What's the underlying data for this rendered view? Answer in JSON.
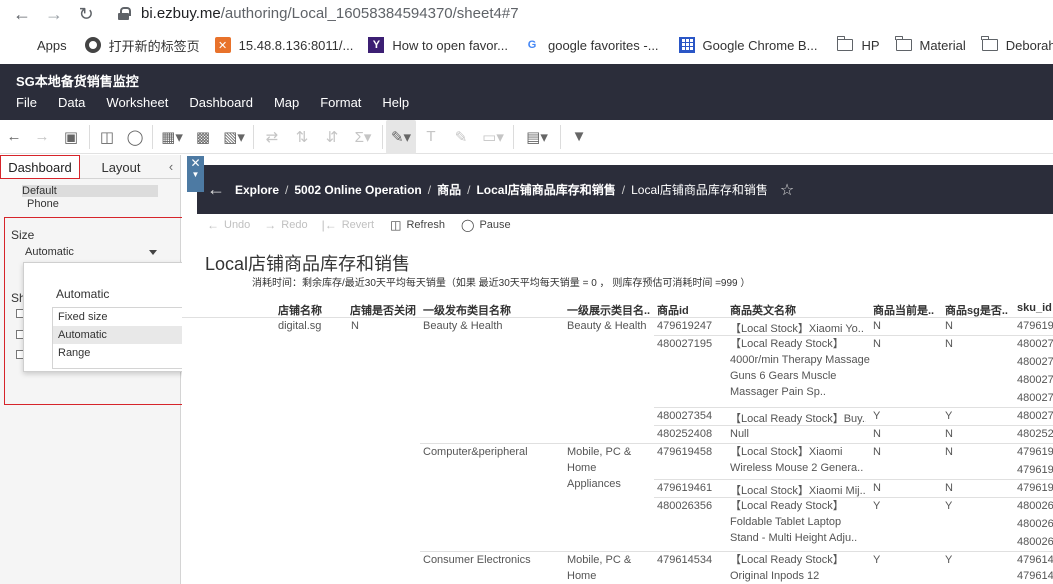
{
  "browser": {
    "url_host": "bi.ezbuy.me",
    "url_path": "/authoring/Local_16058384594370/sheet4#7",
    "bookmarks": [
      {
        "label": "Apps",
        "icon": "apps-icon"
      },
      {
        "label": "打开新的标签页",
        "icon": "globe-icon"
      },
      {
        "label": "15.48.8.136:8011/...",
        "icon": "xampp-icon"
      },
      {
        "label": "How to open favor...",
        "icon": "yahoo-icon"
      },
      {
        "label": "google favorites -...",
        "icon": "google-icon"
      },
      {
        "label": "Google Chrome B...",
        "icon": "grid-icon"
      },
      {
        "label": "HP",
        "icon": "folder-icon"
      },
      {
        "label": "Material",
        "icon": "folder-icon"
      },
      {
        "label": "Deborah",
        "icon": "folder-icon"
      }
    ]
  },
  "app": {
    "title": "SG本地备货销售监控",
    "menu": [
      "File",
      "Data",
      "Worksheet",
      "Dashboard",
      "Map",
      "Format",
      "Help"
    ]
  },
  "pane": {
    "tab_dashboard": "Dashboard",
    "tab_layout": "Layout",
    "device_default": "Default",
    "device_phone": "Phone",
    "size_label": "Size",
    "size_value": "Automatic",
    "sheets_label_partial": "Sh"
  },
  "popup": {
    "selected": "Automatic",
    "options": [
      "Fixed size",
      "Automatic",
      "Range"
    ]
  },
  "canvas": {
    "breadcrumbs": [
      "Explore",
      "5002 Online Operation",
      "商品",
      "Local店铺商品库存和销售",
      "Local店铺商品库存和销售"
    ],
    "toolbar": {
      "undo": "Undo",
      "redo": "Redo",
      "revert": "Revert",
      "refresh": "Refresh",
      "pause": "Pause"
    },
    "title": "Local店铺商品库存和销售",
    "subtitle": "消耗时间：剩余库存/最近30天平均每天销量（如果 最近30天平均每天销量 = 0 ， 则库存预估可消耗时间 =999 ）",
    "columns": [
      "店铺名称",
      "店铺是否关闭",
      "一级发布类目名称",
      "一级展示类目名..",
      "商品id",
      "商品英文名称",
      "商品当前是..",
      "商品sg是否..",
      "sku_id"
    ],
    "store": "digital.sg",
    "store_closed": "N",
    "cat_beauty": "Beauty & Health",
    "cat_beauty_disp": "Beauty & Health",
    "cat_computer": "Computer&peripheral",
    "cat_computer_disp": "Mobile, PC & Home Appliances",
    "cat_consumer": "Consumer Electronics",
    "cat_consumer_disp": "Mobile, PC & Home",
    "rows": [
      {
        "id": "479619247",
        "name": "【Local Stock】Xiaomi Yo..",
        "a": "N",
        "b": "N"
      },
      {
        "id": "480027195",
        "name": "【Local Ready Stock】4000r/min Therapy Massage Guns 6 Gears Muscle Massager Pain Sp..",
        "a": "N",
        "b": "N"
      },
      {
        "id": "480027354",
        "name": "【Local Ready Stock】Buy..",
        "a": "Y",
        "b": "Y"
      },
      {
        "id": "480252408",
        "name": "Null",
        "a": "N",
        "b": "N"
      },
      {
        "id": "479619458",
        "name": "【Local Stock】Xiaomi Wireless Mouse 2 Genera..",
        "a": "N",
        "b": "N"
      },
      {
        "id": "479619461",
        "name": "【Local Stock】Xiaomi Mij..",
        "a": "N",
        "b": "N"
      },
      {
        "id": "480026356",
        "name": "【Local Ready Stock】Foldable Tablet Laptop Stand - Multi Height Adju..",
        "a": "Y",
        "b": "Y"
      },
      {
        "id": "479614534",
        "name": "【Local Ready Stock】Original Inpods 12",
        "a": "Y",
        "b": "Y"
      }
    ],
    "sku_ids": [
      "479619",
      "480027",
      "480027",
      "480027",
      "480027",
      "480027",
      "480252",
      "479619",
      "479619",
      "479619",
      "480026",
      "480026",
      "480026",
      "479614",
      "479614"
    ]
  }
}
